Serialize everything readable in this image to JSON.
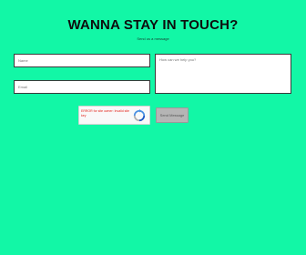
{
  "header": {
    "title": "WANNA STAY IN TOUCH?",
    "subtitle": "Send us a message"
  },
  "form": {
    "name_placeholder": "Name",
    "email_placeholder": "Email",
    "message_placeholder": "How can we help you?",
    "submit_label": "Send Message"
  },
  "captcha": {
    "error_text": "ERROR for site owner: Invalid site key",
    "icon": "recaptcha-logo-icon"
  },
  "colors": {
    "background": "#12f7a6",
    "title": "#0d0d0d",
    "error": "#e2231a",
    "button": "#b5b5b5"
  }
}
